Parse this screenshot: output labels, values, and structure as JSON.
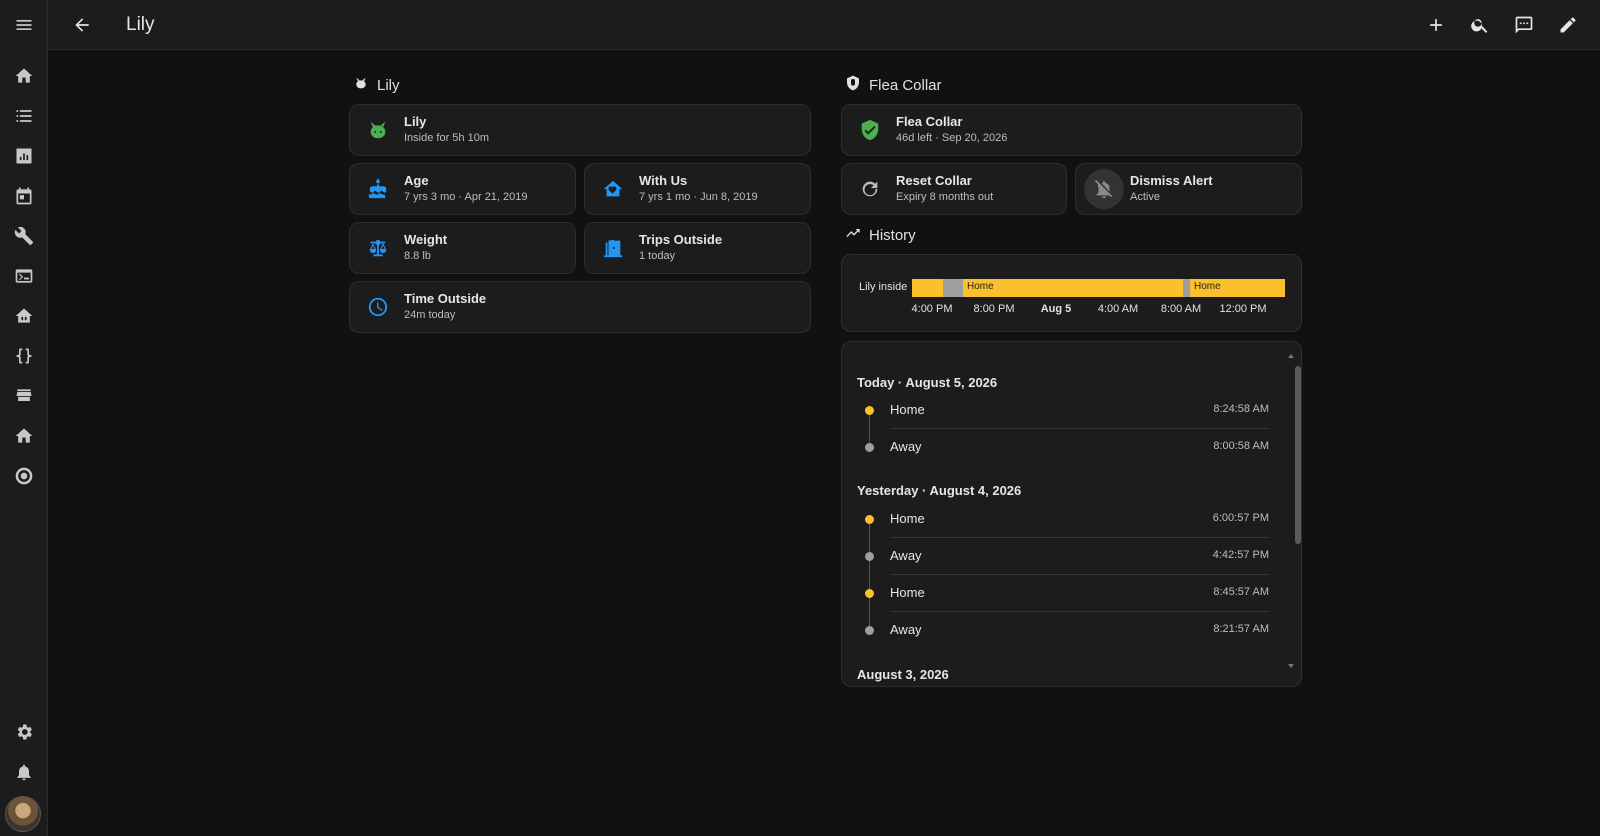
{
  "topbar": {
    "title": "Lily"
  },
  "lily_section": {
    "heading": "Lily",
    "tiles": {
      "lily": {
        "name": "Lily",
        "state": "Inside for 5h 10m"
      },
      "age": {
        "name": "Age",
        "state": "7 yrs 3 mo · Apr 21, 2019"
      },
      "with_us": {
        "name": "With Us",
        "state": "7 yrs 1 mo · Jun 8, 2019"
      },
      "weight": {
        "name": "Weight",
        "state": "8.8 lb"
      },
      "trips": {
        "name": "Trips Outside",
        "state": "1 today"
      },
      "time_outside": {
        "name": "Time Outside",
        "state": "24m today"
      }
    }
  },
  "flea_section": {
    "heading": "Flea Collar",
    "tiles": {
      "collar": {
        "name": "Flea Collar",
        "state": "46d left · Sep 20, 2026"
      },
      "reset": {
        "name": "Reset Collar",
        "state": "Expiry 8 months out"
      },
      "dismiss": {
        "name": "Dismiss Alert",
        "state": "Active"
      }
    }
  },
  "history_section": {
    "heading": "History",
    "timeline": {
      "entity_label": "Lily inside",
      "segment_label_1": "Home",
      "segment_label_2": "Home",
      "ticks": [
        "4:00 PM",
        "8:00 PM",
        "Aug 5",
        "4:00 AM",
        "8:00 AM",
        "12:00 PM"
      ],
      "colors": {
        "home": "#fbc02d",
        "away": "#9e9e9e"
      }
    }
  },
  "logbook": {
    "days": [
      {
        "label": "Today · August 5, 2026",
        "entries": [
          {
            "state": "Home",
            "time": "8:24:58 AM"
          },
          {
            "state": "Away",
            "time": "8:00:58 AM"
          }
        ]
      },
      {
        "label": "Yesterday · August 4, 2026",
        "entries": [
          {
            "state": "Home",
            "time": "6:00:57 PM"
          },
          {
            "state": "Away",
            "time": "4:42:57 PM"
          },
          {
            "state": "Home",
            "time": "8:45:57 AM"
          },
          {
            "state": "Away",
            "time": "8:21:57 AM"
          }
        ]
      },
      {
        "label": "August 3, 2026",
        "entries": []
      }
    ]
  }
}
